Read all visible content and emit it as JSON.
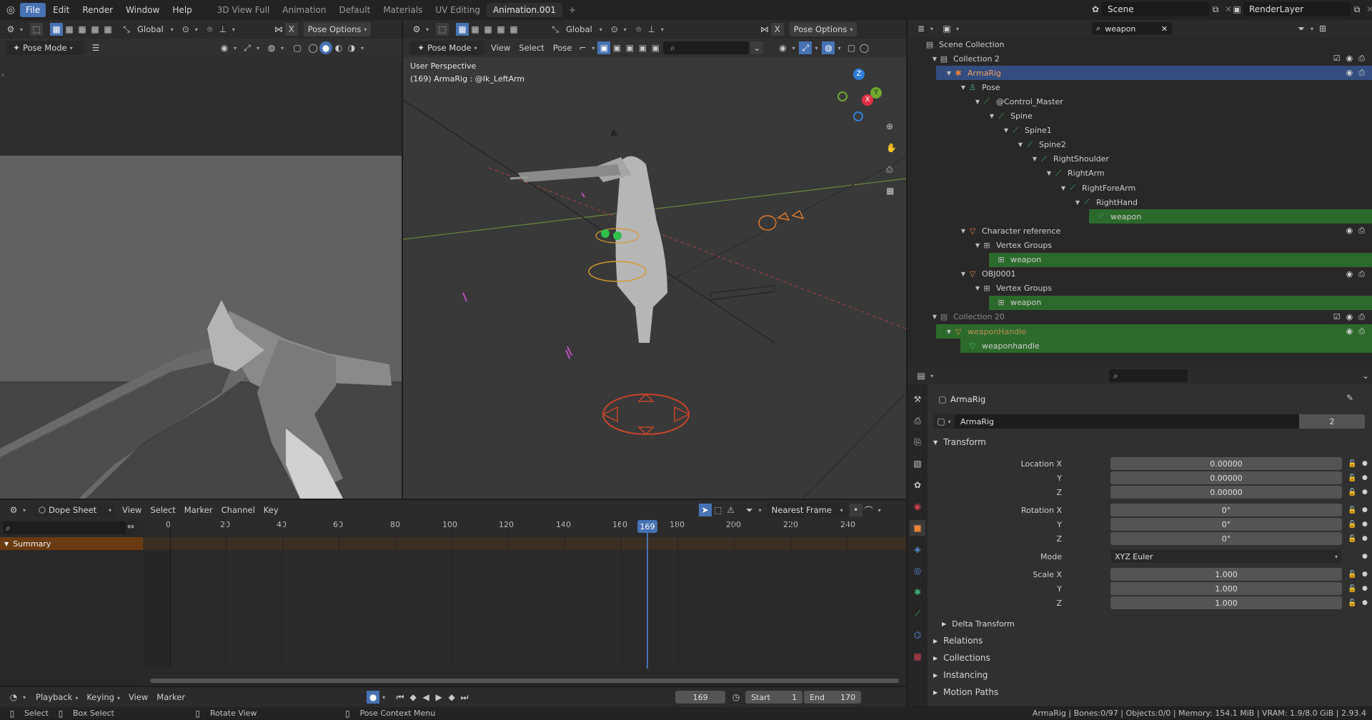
{
  "topbar": {
    "menus": [
      "File",
      "Edit",
      "Render",
      "Window",
      "Help"
    ],
    "workspaces": [
      "3D View Full",
      "Animation",
      "Default",
      "Materials",
      "UV Editing",
      "Animation.001"
    ],
    "add_tab": "+",
    "scene": "Scene",
    "view_layer": "RenderLayer"
  },
  "left_view": {
    "mode": "Pose Mode",
    "orientation": "Global",
    "pose_options": "Pose Options"
  },
  "main_view": {
    "mode": "Pose Mode",
    "menus": [
      "View",
      "Select",
      "Pose"
    ],
    "orientation": "Global",
    "pose_options": "Pose Options",
    "overlay_title": "User Perspective",
    "overlay_sub": "(169) ArmaRig : @Ik_LeftArm",
    "gizmo": {
      "z": "Z",
      "y": "Y",
      "x": "X"
    }
  },
  "outliner": {
    "search_value": "weapon",
    "items": [
      {
        "label": "Scene Collection",
        "indent": 0,
        "icon": "scene-collection-icon",
        "glyph": "▤",
        "color": "#bbbbbb",
        "arrow": ""
      },
      {
        "label": "Collection 2",
        "indent": 1,
        "icon": "collection-icon",
        "glyph": "▤",
        "color": "#bbbbbb",
        "arrow": "▼"
      },
      {
        "label": "ArmaRig",
        "indent": 2,
        "icon": "armature-icon",
        "glyph": "✱",
        "color": "#e8823a",
        "arrow": "▼"
      },
      {
        "label": "Pose",
        "indent": 3,
        "icon": "pose-icon",
        "glyph": "♙",
        "color": "#40b07a",
        "arrow": "▼"
      },
      {
        "label": "@Control_Master",
        "indent": 4,
        "icon": "bone-icon",
        "glyph": "⟋",
        "color": "#40b07a",
        "arrow": "▼"
      },
      {
        "label": "Spine",
        "indent": 5,
        "icon": "bone-icon",
        "glyph": "⟋",
        "color": "#40b07a",
        "arrow": "▼"
      },
      {
        "label": "Spine1",
        "indent": 6,
        "icon": "bone-icon",
        "glyph": "⟋",
        "color": "#40b07a",
        "arrow": "▼"
      },
      {
        "label": "Spine2",
        "indent": 7,
        "icon": "bone-icon",
        "glyph": "⟋",
        "color": "#40b07a",
        "arrow": "▼"
      },
      {
        "label": "RightShoulder",
        "indent": 8,
        "icon": "bone-icon",
        "glyph": "⟋",
        "color": "#40b07a",
        "arrow": "▼"
      },
      {
        "label": "RightArm",
        "indent": 9,
        "icon": "bone-icon",
        "glyph": "⟋",
        "color": "#40b07a",
        "arrow": "▼"
      },
      {
        "label": "RightForeArm",
        "indent": 10,
        "icon": "bone-icon",
        "glyph": "⟋",
        "color": "#40b07a",
        "arrow": "▼"
      },
      {
        "label": "RightHand",
        "indent": 11,
        "icon": "bone-icon",
        "glyph": "⟋",
        "color": "#40b07a",
        "arrow": "▼"
      },
      {
        "label": "weapon",
        "indent": 12,
        "icon": "bone-icon",
        "glyph": "⟋",
        "color": "#40b07a",
        "arrow": ""
      },
      {
        "label": "Character reference",
        "indent": 3,
        "icon": "mesh-object-icon",
        "glyph": "▽",
        "color": "#e8823a",
        "arrow": "▼"
      },
      {
        "label": "Vertex Groups",
        "indent": 4,
        "icon": "vertex-groups-icon",
        "glyph": "⊞",
        "color": "#bbbbbb",
        "arrow": "▼"
      },
      {
        "label": "weapon",
        "indent": 5,
        "icon": "vertex-group-icon",
        "glyph": "⊞",
        "color": "#bbbbbb",
        "arrow": ""
      },
      {
        "label": "OBJ0001",
        "indent": 3,
        "icon": "mesh-object-icon",
        "glyph": "▽",
        "color": "#e8823a",
        "arrow": "▼"
      },
      {
        "label": "Vertex Groups",
        "indent": 4,
        "icon": "vertex-groups-icon",
        "glyph": "⊞",
        "color": "#bbbbbb",
        "arrow": "▼"
      },
      {
        "label": "weapon",
        "indent": 5,
        "icon": "vertex-group-icon",
        "glyph": "⊞",
        "color": "#bbbbbb",
        "arrow": ""
      },
      {
        "label": "Collection 20",
        "indent": 1,
        "icon": "collection-icon",
        "glyph": "▤",
        "color": "#888888",
        "arrow": "▼"
      },
      {
        "label": "weaponHandle",
        "indent": 2,
        "icon": "mesh-object-icon",
        "glyph": "▽",
        "color": "#e8823a",
        "arrow": "▼"
      },
      {
        "label": "weaponhandle",
        "indent": 3,
        "icon": "mesh-data-icon",
        "glyph": "▽",
        "color": "#40b07a",
        "arrow": ""
      }
    ]
  },
  "properties": {
    "object_name": "ArmaRig",
    "data_name": "ArmaRig",
    "users": "2",
    "transform_title": "Transform",
    "location_label": "Location X",
    "rotation_label": "Rotation X",
    "scale_label": "Scale X",
    "y_label": "Y",
    "z_label": "Z",
    "location": [
      "0.00000",
      "0.00000",
      "0.00000"
    ],
    "rotation": [
      "0°",
      "0°",
      "0°"
    ],
    "mode_label": "Mode",
    "mode_value": "XYZ Euler",
    "scale": [
      "1.000",
      "1.000",
      "1.000"
    ],
    "subsections": [
      "Delta Transform",
      "Relations",
      "Collections",
      "Instancing",
      "Motion Paths"
    ]
  },
  "dopesheet": {
    "editor": "Dope Sheet",
    "menus": [
      "View",
      "Select",
      "Marker",
      "Channel",
      "Key"
    ],
    "snap": "Nearest Frame",
    "summary": "Summary",
    "current_frame": "169",
    "ticks": [
      "0",
      "20",
      "40",
      "60",
      "80",
      "100",
      "120",
      "140",
      "160",
      "180",
      "200",
      "220",
      "240"
    ]
  },
  "timeline": {
    "menus": [
      "Playback",
      "Keying",
      "View",
      "Marker"
    ],
    "frame": "169",
    "start_label": "Start",
    "start": "1",
    "end_label": "End",
    "end": "170"
  },
  "statusbar": {
    "select": "Select",
    "box_select": "Box Select",
    "rotate_view": "Rotate View",
    "context_menu": "Pose Context Menu",
    "info": "ArmaRig | Bones:0/97 | Objects:0/0 | Memory: 154.1 MiB | VRAM: 1.9/8.0 GiB | 2.93.4"
  }
}
